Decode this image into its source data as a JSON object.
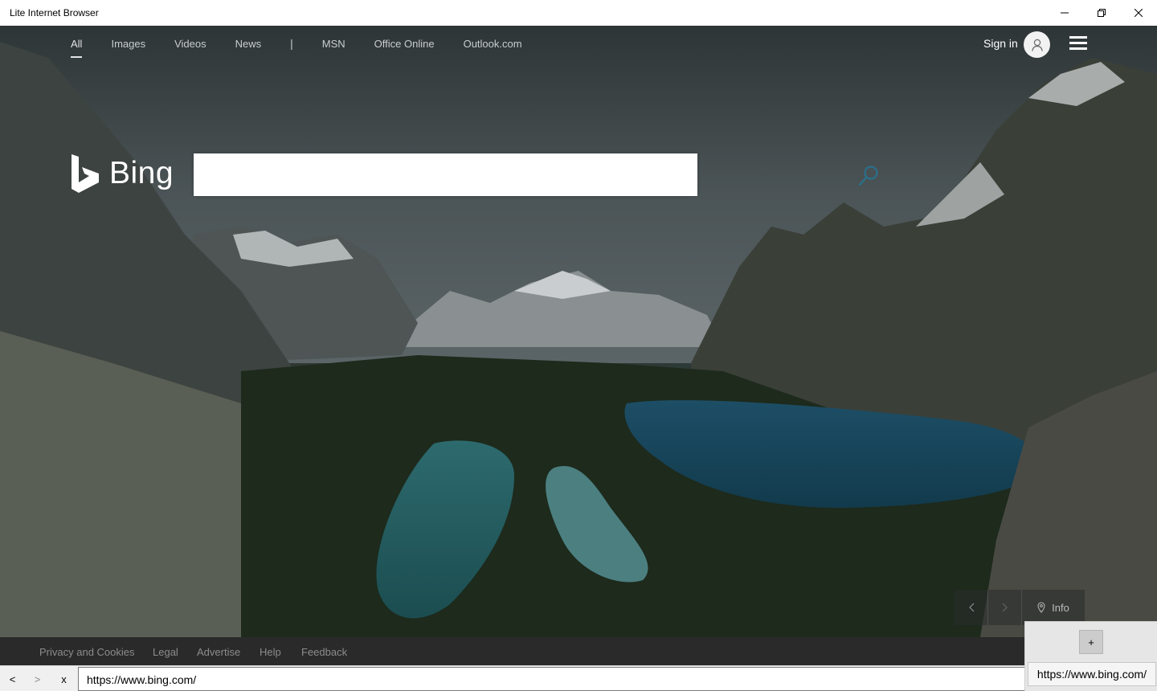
{
  "window": {
    "title": "Lite Internet Browser",
    "controls": {
      "minimize": "minimize-icon",
      "restore": "restore-icon",
      "close": "close-icon"
    }
  },
  "bing": {
    "nav": [
      {
        "label": "All",
        "active": true
      },
      {
        "label": "Images"
      },
      {
        "label": "Videos"
      },
      {
        "label": "News"
      },
      {
        "label": "|"
      },
      {
        "label": "MSN"
      },
      {
        "label": "Office Online"
      },
      {
        "label": "Outlook.com"
      }
    ],
    "sign_in": "Sign in",
    "logo_text": "Bing",
    "search": {
      "value": "",
      "placeholder": ""
    },
    "image_strip": {
      "info_label": "Info"
    },
    "footer_links": [
      "Privacy and Cookies",
      "Legal",
      "Advertise",
      "Help",
      "Feedback"
    ]
  },
  "toolbar": {
    "back": "<",
    "forward": ">",
    "stop": "x",
    "url": "https://www.bing.com/"
  },
  "tabs": {
    "new_tab": "+",
    "items": [
      "https://www.bing.com/"
    ]
  },
  "colors": {
    "footer_bg": "#2a2a2a",
    "toolbar_bg": "#f0f0f0",
    "search_icon": "#2b6f8a"
  }
}
